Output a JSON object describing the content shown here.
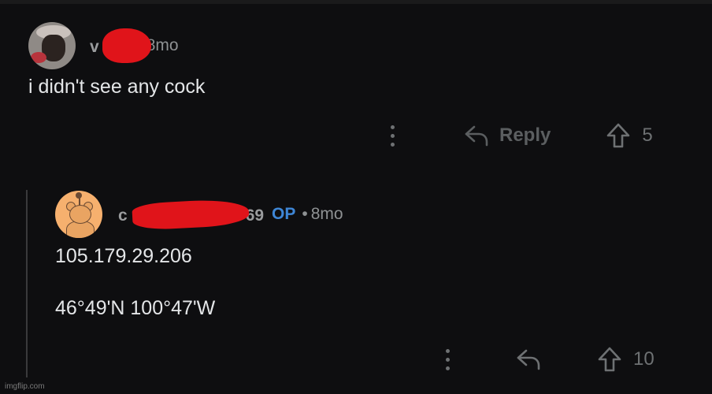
{
  "comments": [
    {
      "username_visible": "v",
      "time": "8mo",
      "body": "i didn't see any cock",
      "reply_label": "Reply",
      "upvotes": "5"
    },
    {
      "username_start": "c",
      "username_end": "69",
      "op_badge": "OP",
      "separator": "•",
      "time": "8mo",
      "body_line1": "105.179.29.206",
      "body_line2": "46°49'N 100°47'W",
      "upvotes": "10"
    }
  ],
  "watermark": "imgflip.com",
  "colors": {
    "background": "#0e0e10",
    "text": "#e4e6e8",
    "muted": "#8e9193",
    "op_badge": "#3e86d6",
    "redaction": "#e0141a"
  },
  "icons": [
    "more-options-icon",
    "reply-arrow-icon",
    "upvote-arrow-icon"
  ]
}
